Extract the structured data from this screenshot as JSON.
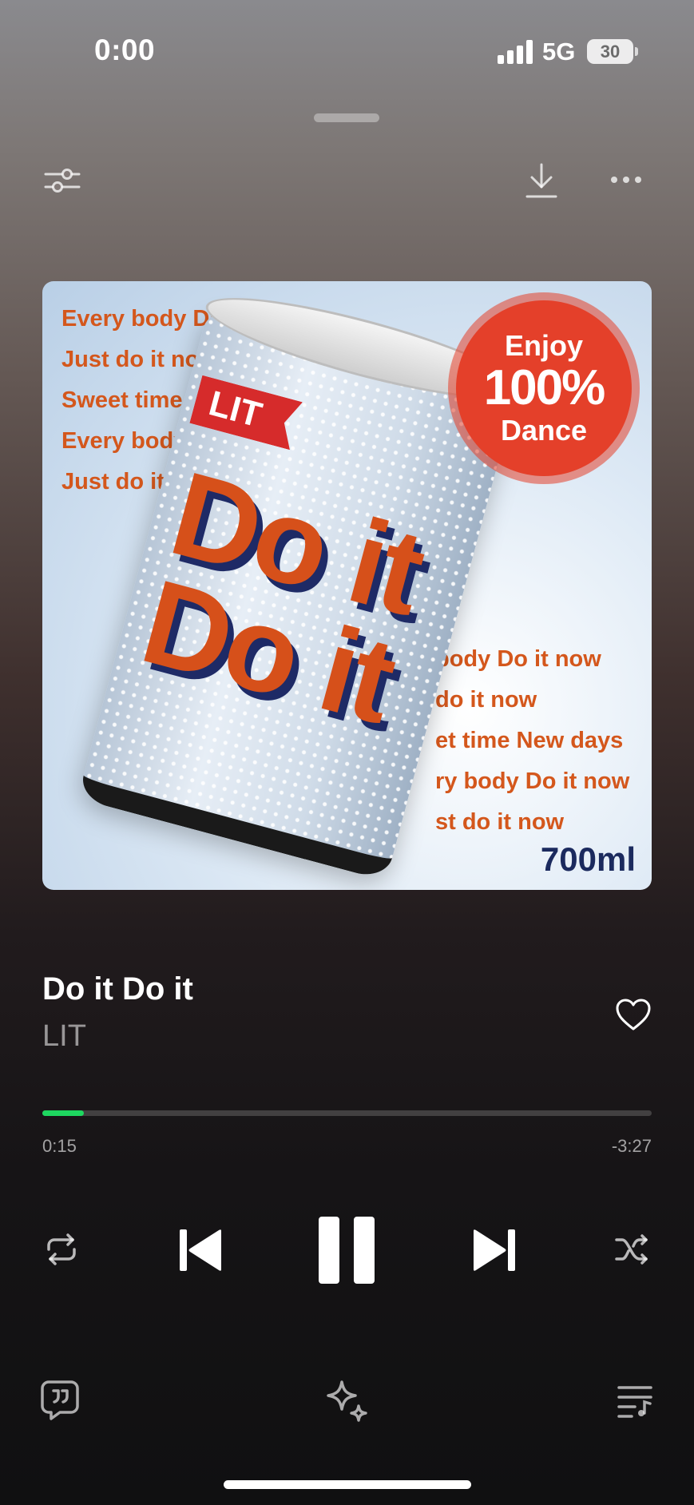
{
  "status_bar": {
    "time": "0:00",
    "network": "5G",
    "battery": "30"
  },
  "artwork": {
    "lines_left": [
      "Every body Do it",
      "Just do it now",
      "Sweet time",
      "Every body",
      "Just do it"
    ],
    "lines_right": [
      "body Do it now",
      "do it now",
      "et time New days",
      "ry body Do it now",
      "st do it now"
    ],
    "can_label": "LIT",
    "can_text": "Do it Do it",
    "badge": {
      "top": "Enjoy",
      "middle": "100%",
      "bottom": "Dance"
    },
    "volume": "700ml"
  },
  "track": {
    "title": "Do it Do it",
    "artist": "LIT",
    "liked": false
  },
  "playback": {
    "elapsed": "0:15",
    "remaining": "-3:27",
    "progress_fraction": 0.068,
    "is_playing": true
  },
  "colors": {
    "progress_fill": "#1ed760"
  },
  "icons": {
    "top_left": "sliders-icon",
    "top_right": [
      "download-icon",
      "more-icon"
    ],
    "controls": [
      "repeat-icon",
      "previous-icon",
      "pause-icon",
      "next-icon",
      "shuffle-icon"
    ],
    "bottom": [
      "lyrics-icon",
      "sparkle-icon",
      "queue-icon"
    ]
  }
}
